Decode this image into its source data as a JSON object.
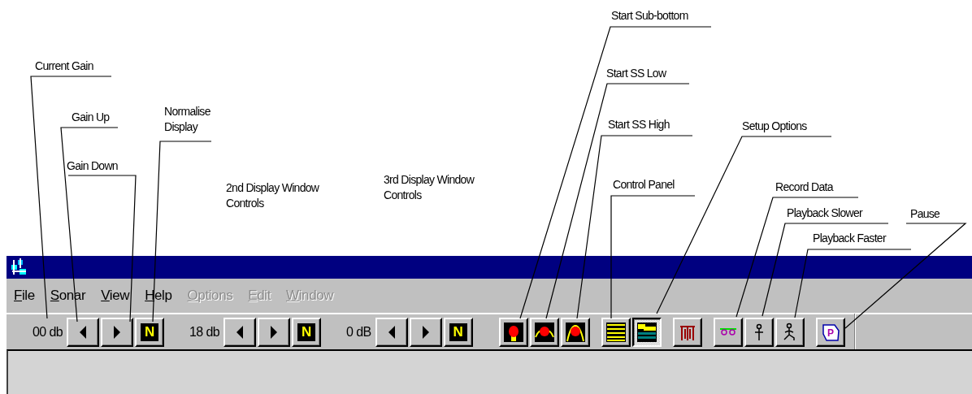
{
  "callouts": [
    {
      "text": "Current Gain"
    },
    {
      "text": "Gain Up"
    },
    {
      "text": "Gain Down"
    },
    {
      "text": "Normalise\nDisplay"
    },
    {
      "text": "2nd Display Window\nControls"
    },
    {
      "text": "3rd Display Window\nControls"
    },
    {
      "text": "Start Sub-bottom"
    },
    {
      "text": "Start SS Low"
    },
    {
      "text": "Start SS High"
    },
    {
      "text": "Control Panel"
    },
    {
      "text": "Setup Options"
    },
    {
      "text": "Record Data"
    },
    {
      "text": "Playback Slower"
    },
    {
      "text": "Playback Faster"
    },
    {
      "text": "Pause"
    }
  ],
  "menu": [
    {
      "label": "File",
      "disabled": false
    },
    {
      "label": "Sonar",
      "disabled": false
    },
    {
      "label": "View",
      "disabled": false
    },
    {
      "label": "Help",
      "disabled": false
    },
    {
      "label": "Options",
      "disabled": true
    },
    {
      "label": "Edit",
      "disabled": true
    },
    {
      "label": "Window",
      "disabled": true
    }
  ],
  "gain_groups": [
    {
      "reading": "00 db",
      "normalise_label": "N"
    },
    {
      "reading": "18 db",
      "normalise_label": "N"
    },
    {
      "reading": "0 dB",
      "normalise_label": "N"
    }
  ],
  "tool_groups": [
    {
      "tools": [
        {
          "kind": "sub-bottom",
          "pressed": false
        },
        {
          "kind": "ss-low",
          "pressed": false
        },
        {
          "kind": "ss-high",
          "pressed": false
        }
      ]
    },
    {
      "tools": [
        {
          "kind": "control-panel",
          "pressed": false
        },
        {
          "kind": "setup",
          "pressed": true
        }
      ]
    },
    {
      "tools": [
        {
          "kind": "gate",
          "pressed": false
        }
      ]
    },
    {
      "tools": [
        {
          "kind": "record",
          "pressed": false
        },
        {
          "kind": "slower",
          "pressed": false
        },
        {
          "kind": "faster",
          "pressed": false
        }
      ]
    },
    {
      "tools": [
        {
          "kind": "pause",
          "pressed": false,
          "glyph": "P"
        }
      ]
    }
  ]
}
